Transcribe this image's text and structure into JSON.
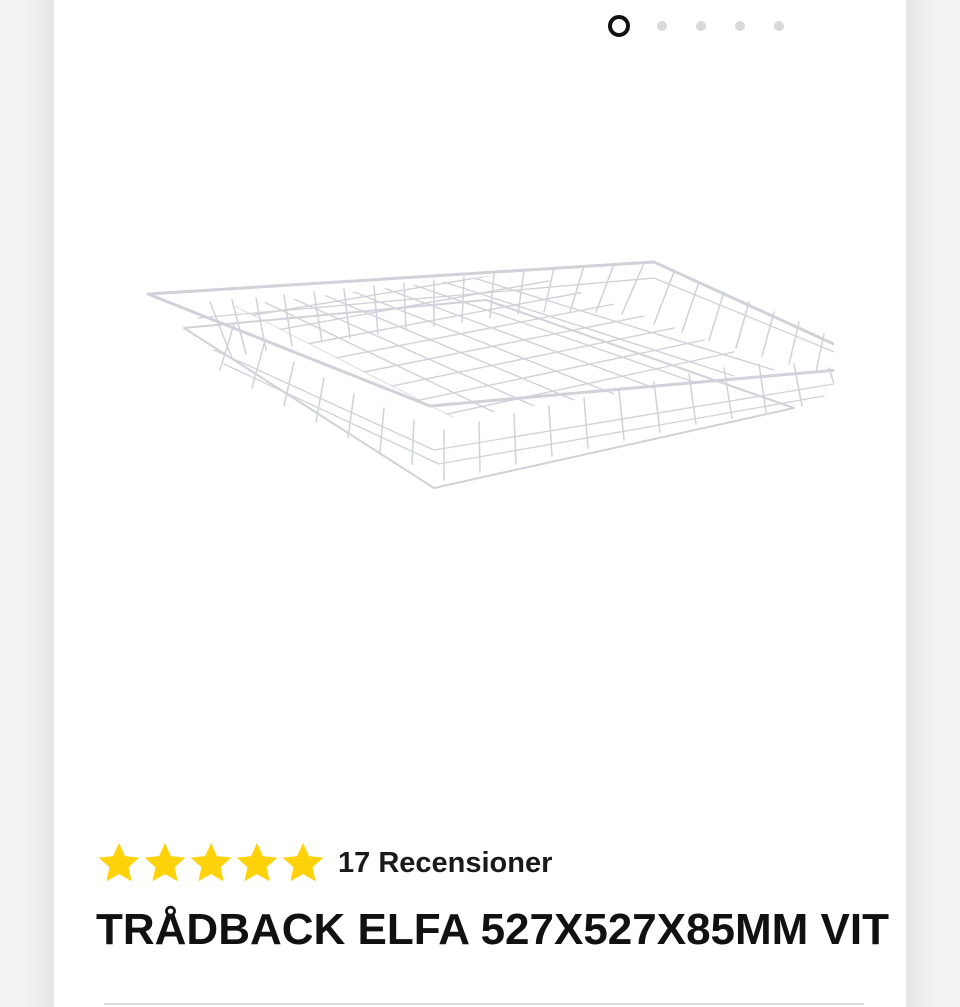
{
  "carousel": {
    "slide_count": 5,
    "active_index": 0
  },
  "product": {
    "image_icon": "wire-basket-icon",
    "rating": 5,
    "rating_max": 5,
    "star_color": "#ffd20a",
    "reviews_label": "17 Recensioner",
    "title": "TRÅDBACK ELFA 527X527X85MM VIT"
  }
}
